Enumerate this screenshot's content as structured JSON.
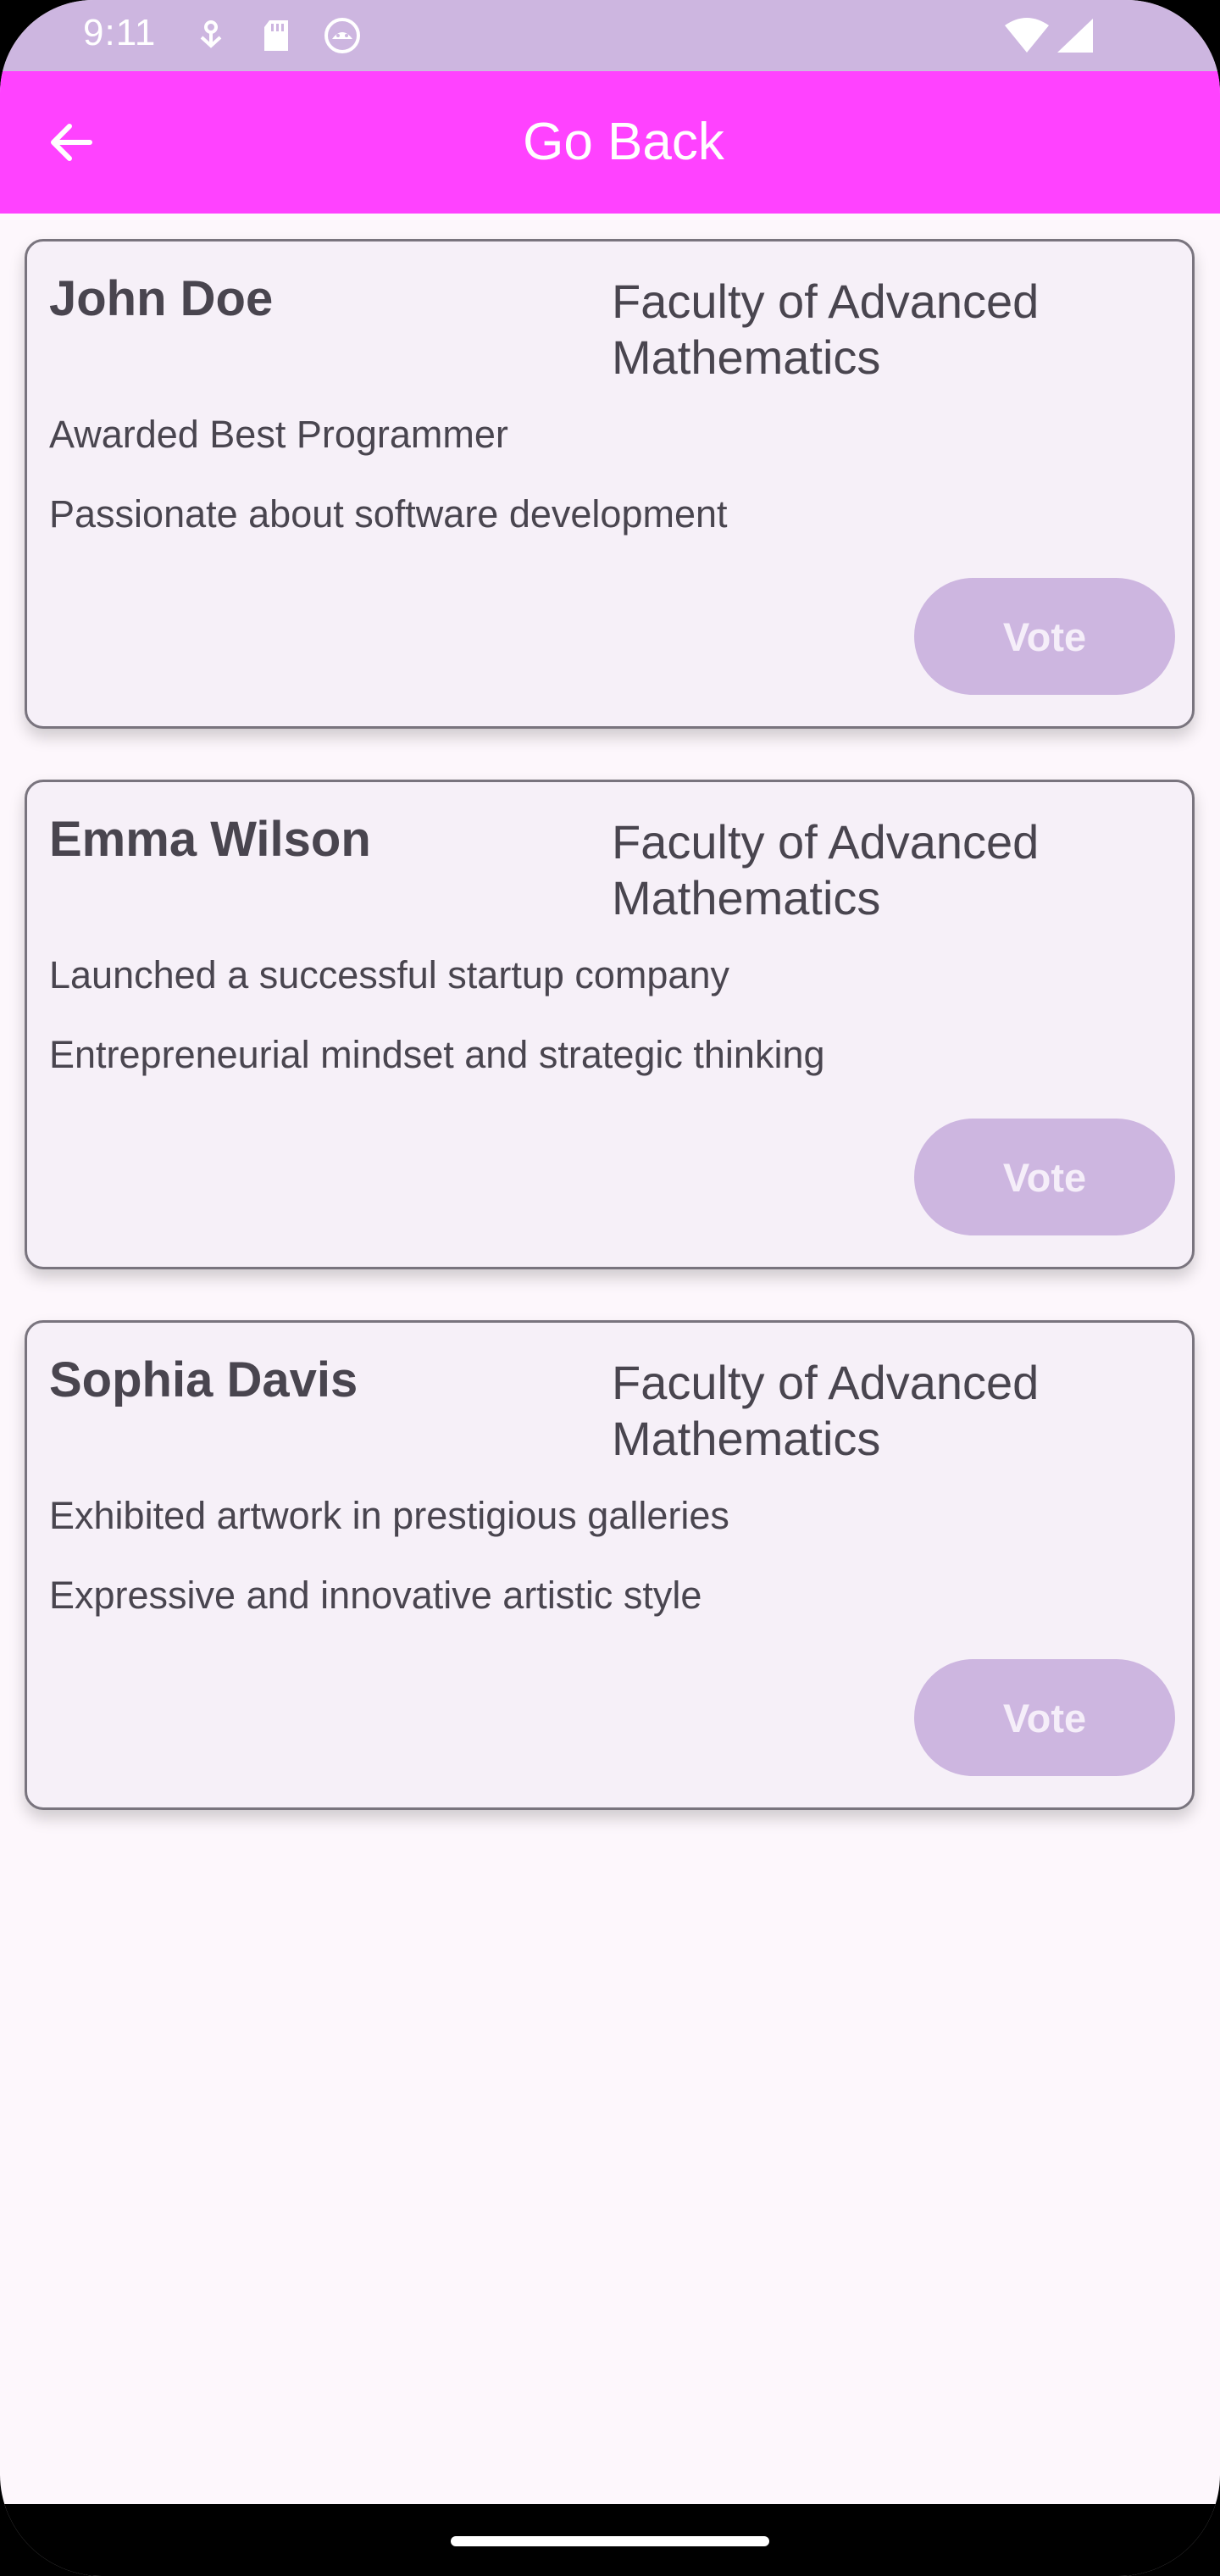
{
  "status_bar": {
    "time": "9:11",
    "icons": [
      "notification-icon",
      "sd-card-icon",
      "android-icon",
      "wifi-icon",
      "signal-icon"
    ]
  },
  "app_bar": {
    "back_icon": "arrow-back-icon",
    "title": "Go Back"
  },
  "candidates": [
    {
      "name": "John Doe",
      "faculty": "Faculty of Advanced Mathematics",
      "award": "Awarded Best Programmer",
      "description": "Passionate about software development",
      "vote_label": "Vote"
    },
    {
      "name": "Emma Wilson",
      "faculty": "Faculty of Advanced Mathematics",
      "award": "Launched a successful startup company",
      "description": "Entrepreneurial mindset and strategic thinking",
      "vote_label": "Vote"
    },
    {
      "name": "Sophia Davis",
      "faculty": "Faculty of Advanced Mathematics",
      "award": "Exhibited artwork in prestigious galleries",
      "description": "Expressive and innovative artistic style",
      "vote_label": "Vote"
    }
  ],
  "colors": {
    "status_bar": "#cdb6e0",
    "app_bar": "#ff42ff",
    "card_background": "#f6f0f8",
    "vote_button": "#cdb6e0",
    "text": "#49454f"
  }
}
